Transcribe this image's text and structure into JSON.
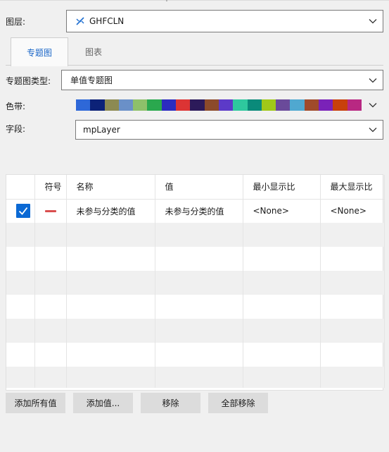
{
  "layer": {
    "label": "图层:",
    "value": "GHFCLN",
    "icon": "line-layer-icon"
  },
  "tabs": [
    {
      "label": "专题图",
      "active": true
    },
    {
      "label": "图表",
      "active": false
    }
  ],
  "theme_type": {
    "label": "专题图类型:",
    "value": "单值专题图"
  },
  "color_ramp": {
    "label": "色带:",
    "colors": [
      "#2e68d8",
      "#0c2278",
      "#8c8a52",
      "#6a90c8",
      "#8ec06a",
      "#2aa84e",
      "#2c2cc0",
      "#dc3434",
      "#2c1a5a",
      "#8c4a2a",
      "#5c3ac8",
      "#2ec89e",
      "#0a8a7a",
      "#a0c818",
      "#6a4a9a",
      "#50a8d0",
      "#a04a2a",
      "#7a22b8",
      "#c8400c",
      "#b82882"
    ]
  },
  "field": {
    "label": "字段:",
    "value": "mpLayer"
  },
  "table": {
    "headers": [
      "",
      "符号",
      "名称",
      "值",
      "最小显示比",
      "最大显示比"
    ],
    "rows": [
      {
        "checked": true,
        "symbol_color": "#d94f4f",
        "name": "未参与分类的值",
        "value": "未参与分类的值",
        "min_scale": "<None>",
        "max_scale": "<None>"
      }
    ]
  },
  "buttons": {
    "add_all": "添加所有值",
    "add_value": "添加值...",
    "remove": "移除",
    "remove_all": "全部移除"
  }
}
